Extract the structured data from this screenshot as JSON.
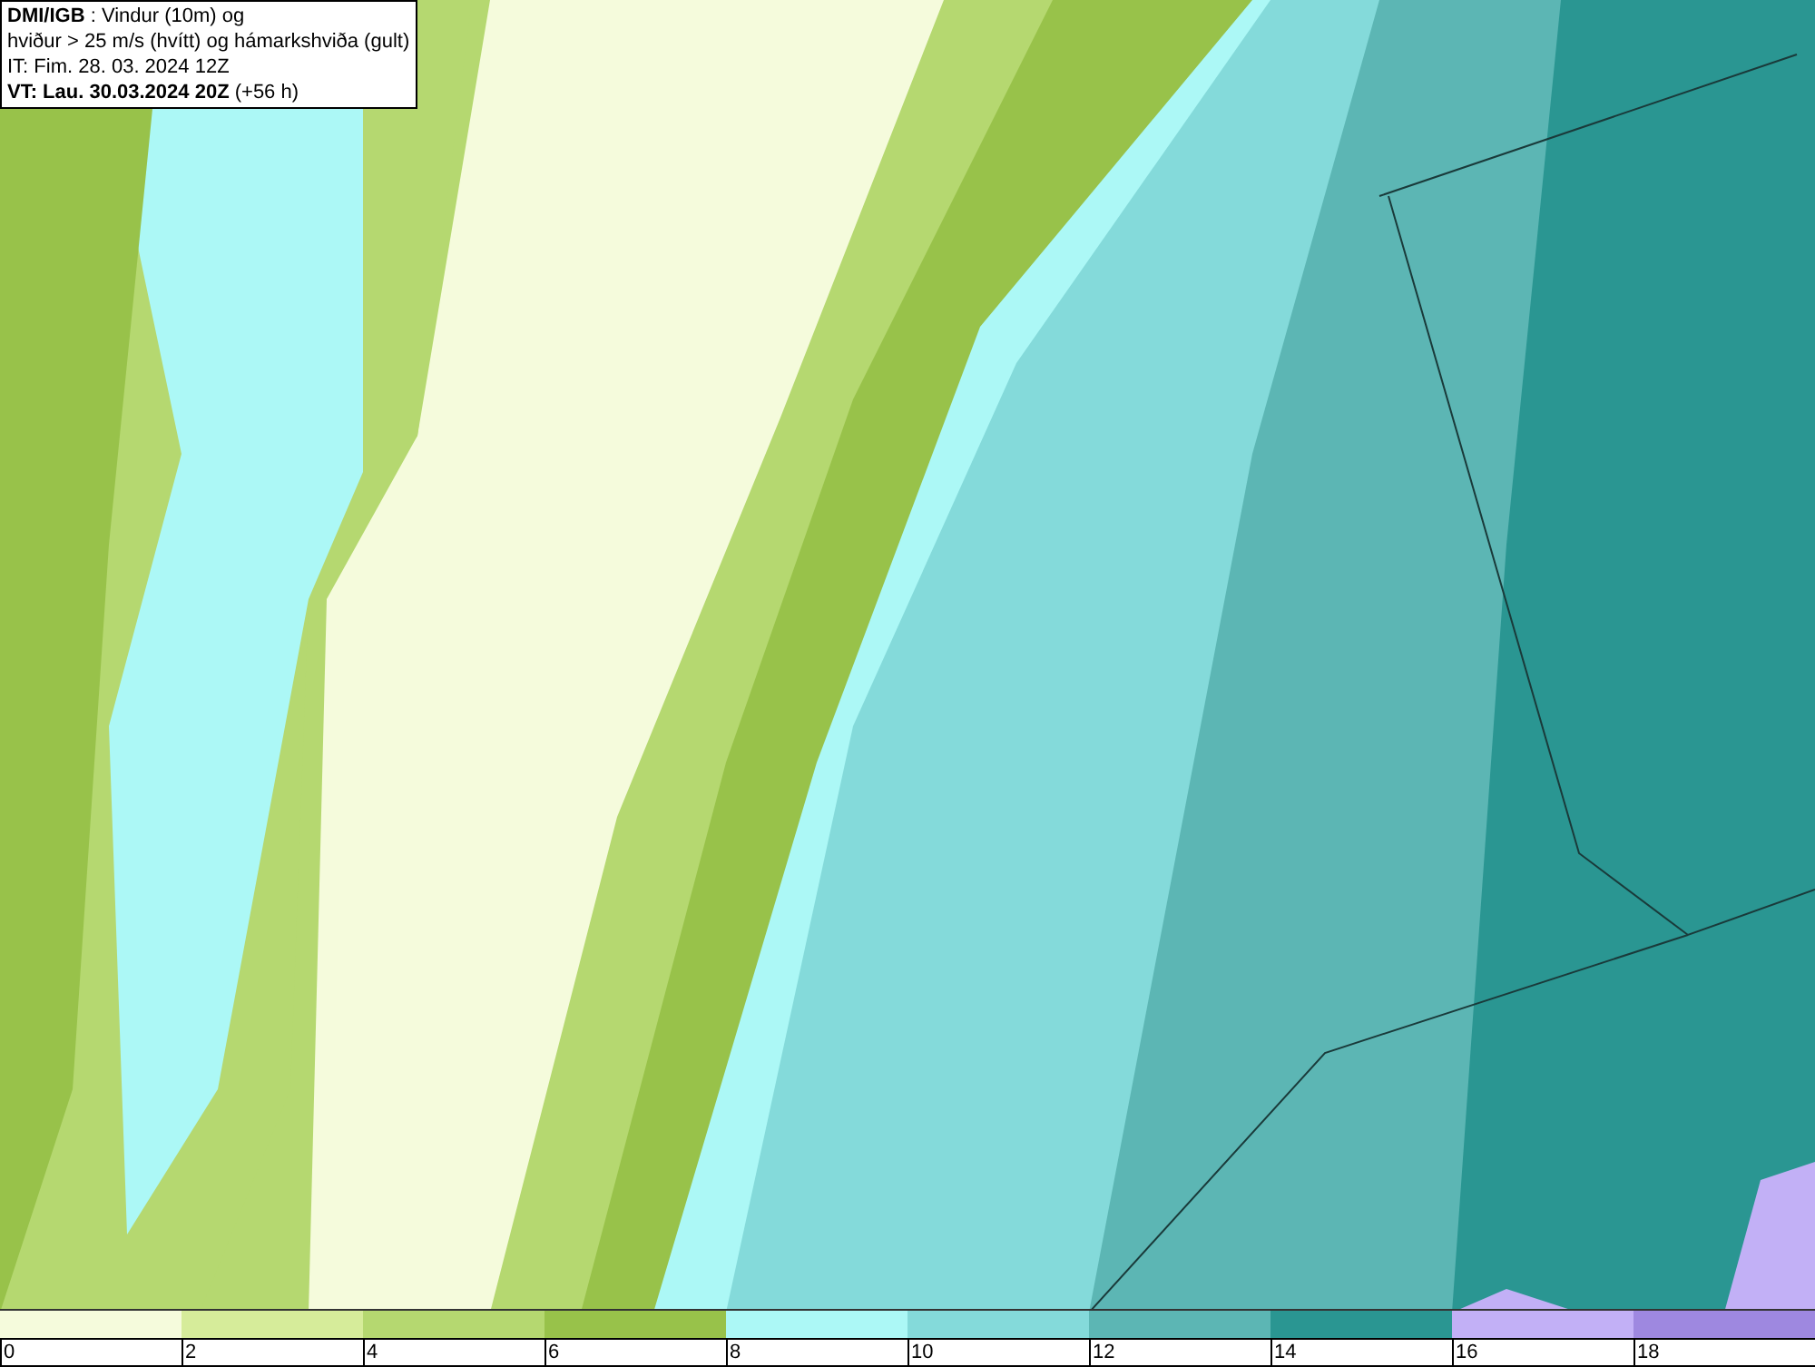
{
  "info_box": {
    "lines": [
      "**DMI/IGB** : Vindur (10m) og",
      "hviður > 25 m/s (hvítt) og hámarkshviða (gult)",
      "IT: Fim. 28. 03. 2024 12Z",
      "**VT: Lau. 30.03.2024 20Z** (+56 h)"
    ]
  },
  "legend": {
    "bins": [
      {
        "color": "#f5fbdc"
      },
      {
        "color": "#d6ec9a"
      },
      {
        "color": "#b5d870"
      },
      {
        "color": "#98c24a"
      },
      {
        "color": "#acf8f6"
      },
      {
        "color": "#84dada"
      },
      {
        "color": "#5cb6b4"
      },
      {
        "color": "#2a9692"
      },
      {
        "color": "#c2b0f6"
      },
      {
        "color": "#9e88e0"
      }
    ],
    "ticks": [
      "0",
      "2",
      "4",
      "6",
      "8",
      "10",
      "12",
      "14",
      "16",
      "18"
    ]
  }
}
